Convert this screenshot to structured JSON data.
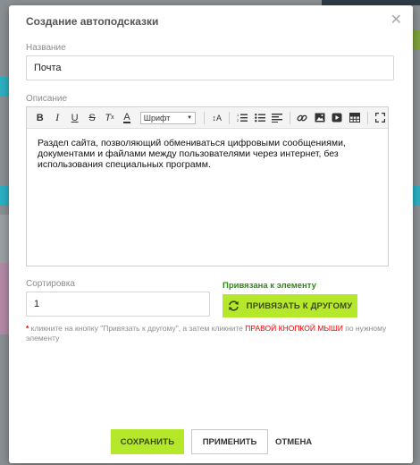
{
  "dialog": {
    "title": "Создание автоподсказки",
    "close_glyph": "✕"
  },
  "name_field": {
    "label": "Название",
    "value": "Почта"
  },
  "description": {
    "label": "Описание",
    "font_select": "Шрифт",
    "text": "Раздел сайта, позволяющий обмениваться цифровыми сообщениями, документами и файлами между пользователями через интернет, без использования специальных программ."
  },
  "sort_field": {
    "label": "Сортировка",
    "value": "1"
  },
  "binding": {
    "status": "Привязана к элементу",
    "button_label": "ПРИВЯЗАТЬ К ДРУГОМУ"
  },
  "hint": {
    "star": "*",
    "part1": " кликните на кнопку \"Привязать к другому\", а затем кликните ",
    "highlight": "ПРАВОЙ КНОПКОЙ МЫШИ",
    "part2": " по нужному элементу"
  },
  "footer": {
    "save": "СОХРАНИТЬ",
    "apply": "ПРИМЕНИТЬ",
    "cancel": "ОТМЕНА"
  },
  "colors": {
    "accent_green": "#b5e82a",
    "status_green": "#2e8b14",
    "highlight_red": "#e00000"
  }
}
